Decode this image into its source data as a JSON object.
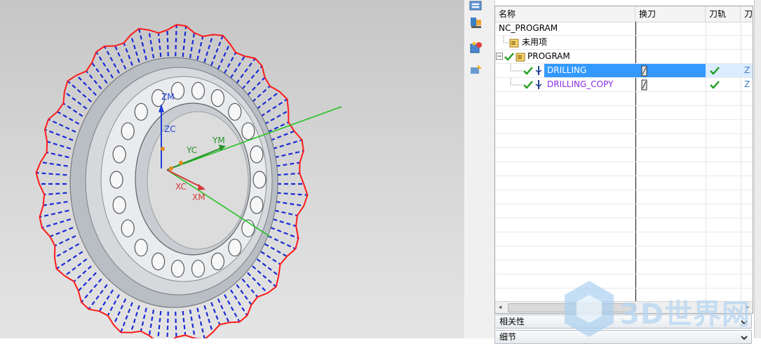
{
  "viewport": {
    "axis_labels": {
      "zm": "ZM",
      "zc": "ZC",
      "yc": "YC",
      "ym": "YM",
      "xc": "XC",
      "xm": "XM"
    }
  },
  "navigator": {
    "columns": [
      "名称",
      "换刀",
      "刀轨",
      "刀"
    ],
    "rows": [
      {
        "label": "NC_PROGRAM",
        "selected": false
      },
      {
        "label": "未用项",
        "selected": false
      },
      {
        "label": "PROGRAM",
        "selected": false
      },
      {
        "label": "DRILLING",
        "selected": true,
        "trail": "Z"
      },
      {
        "label": "DRILLING_COPY",
        "selected": false,
        "trail": "Z"
      }
    ]
  },
  "panels": {
    "related": "相关性",
    "details": "细节"
  },
  "watermark": {
    "text": "3D世界网"
  }
}
